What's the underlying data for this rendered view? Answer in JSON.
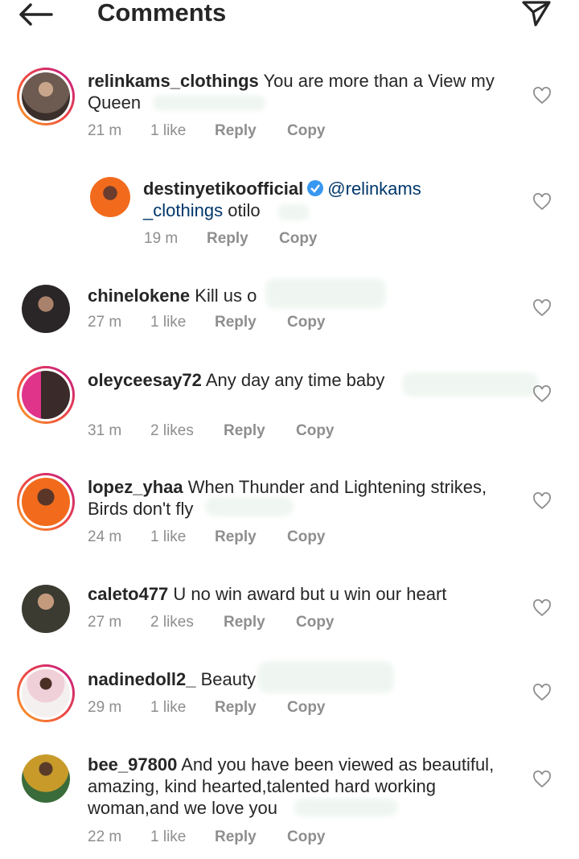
{
  "header": {
    "title": "Comments"
  },
  "comments": [
    {
      "username": "relinkams_clothings",
      "text": "You are more than a View my Queen",
      "time": "21 m",
      "likes": "1 like",
      "reply": "Reply",
      "copy": "Copy"
    },
    {
      "username": "destinyetikoofficial",
      "mention": "@relinkams _clothings",
      "text": "otilo",
      "time": "19 m",
      "likes": "",
      "reply": "Reply",
      "copy": "Copy"
    },
    {
      "username": "chinelokene",
      "text": "Kill us o",
      "time": "27 m",
      "likes": "1 like",
      "reply": "Reply",
      "copy": "Copy"
    },
    {
      "username": "oleyceesay72",
      "text": "Any day any time baby",
      "time": "31 m",
      "likes": "2 likes",
      "reply": "Reply",
      "copy": "Copy"
    },
    {
      "username": "lopez_yhaa",
      "text": "When Thunder and Lightening strikes, Birds don't fly",
      "time": "24 m",
      "likes": "1 like",
      "reply": "Reply",
      "copy": "Copy"
    },
    {
      "username": "caleto477",
      "text": "U no win award but u win our heart",
      "time": "27 m",
      "likes": "2 likes",
      "reply": "Reply",
      "copy": "Copy"
    },
    {
      "username": "nadinedoll2_",
      "text": "Beauty",
      "time": "29 m",
      "likes": "1 like",
      "reply": "Reply",
      "copy": "Copy"
    },
    {
      "username": "bee_97800",
      "text": "And you have been viewed as beautiful, amazing, kind hearted,talented hard working woman,and we love you",
      "time": "22 m",
      "likes": "1 like",
      "reply": "Reply",
      "copy": "Copy"
    }
  ],
  "icons": {
    "back": "arrow-left-icon",
    "send": "paper-plane-icon",
    "like": "heart-outline-icon",
    "verified": "verified-badge-icon"
  },
  "colors": {
    "text": "#262626",
    "meta": "#8e8e8e",
    "mention": "#00376b",
    "verified": "#3897f0"
  }
}
